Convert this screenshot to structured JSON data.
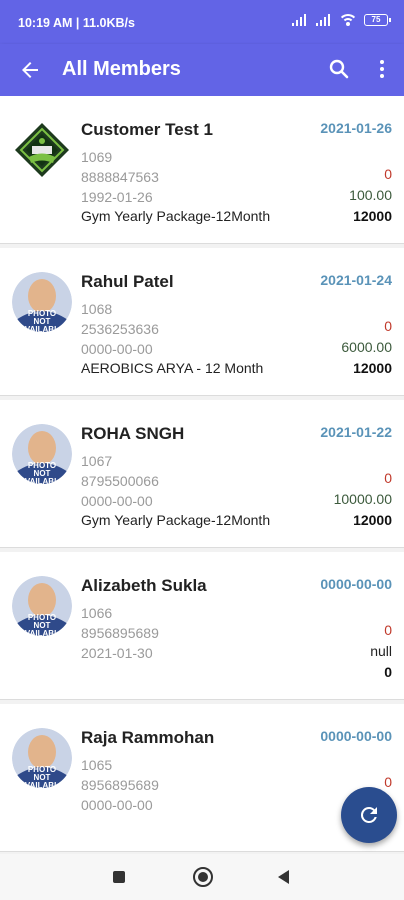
{
  "status": {
    "time": "10:19 AM | 11.0KB/s",
    "battery": "75"
  },
  "header": {
    "title": "All Members"
  },
  "members": [
    {
      "name": "Customer Test 1",
      "id": "1069",
      "phone": "8888847563",
      "dob": "1992-01-26",
      "package": "Gym Yearly Package-12Month",
      "date": "2021-01-26",
      "due": "0",
      "paid": "100.00",
      "total": "12000",
      "avatar": "gym-logo"
    },
    {
      "name": "Rahul Patel",
      "id": "1068",
      "phone": "2536253636",
      "dob": "0000-00-00",
      "package": "AEROBICS ARYA - 12  Month",
      "date": "2021-01-24",
      "due": "0",
      "paid": "6000.00",
      "total": "12000",
      "avatar": "photo-not-available"
    },
    {
      "name": "ROHA SNGH",
      "id": "1067",
      "phone": "8795500066",
      "dob": "0000-00-00",
      "package": "Gym Yearly Package-12Month",
      "date": "2021-01-22",
      "due": "0",
      "paid": "10000.00",
      "total": "12000",
      "avatar": "photo-not-available"
    },
    {
      "name": "Alizabeth Sukla",
      "id": "1066",
      "phone": "8956895689",
      "dob": "2021-01-30",
      "package": "",
      "date": "0000-00-00",
      "due": "0",
      "paid": "null",
      "total": "0",
      "avatar": "photo-not-available"
    },
    {
      "name": "Raja Rammohan",
      "id": "1065",
      "phone": "8956895689",
      "dob": "0000-00-00",
      "package": "",
      "date": "0000-00-00",
      "due": "0",
      "paid": "",
      "total": "",
      "avatar": "photo-not-available"
    }
  ],
  "icons": {
    "back": "arrow-left-icon",
    "search": "search-icon",
    "more": "more-vert-icon",
    "fab": "refresh-icon"
  },
  "colors": {
    "primary": "#6264e6",
    "fab": "#2a4d8f",
    "date": "#5a93b8",
    "due": "#c0392b"
  }
}
